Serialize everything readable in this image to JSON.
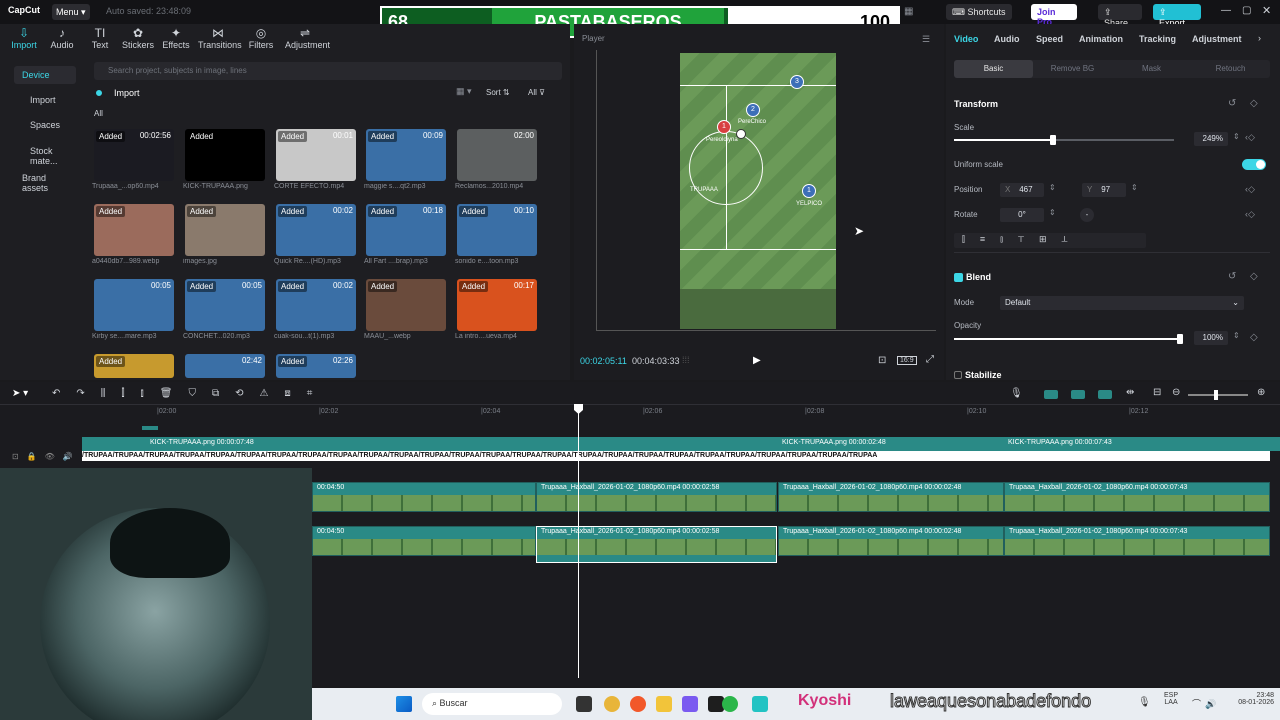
{
  "app": {
    "logo": "CapCut",
    "menu": "Menu",
    "autosave": "Auto saved: 23:48:09"
  },
  "window_buttons": {
    "shortcuts": "Shortcuts",
    "join_pro": "Join Pro",
    "share": "Share",
    "export": "Export"
  },
  "scoreboard": {
    "left_score": "68",
    "team": "PASTABASEROS",
    "right_score": "100"
  },
  "toolbar": [
    {
      "label": "Import",
      "icon": "import-icon"
    },
    {
      "label": "Audio",
      "icon": "audio-icon"
    },
    {
      "label": "Text",
      "icon": "text-icon"
    },
    {
      "label": "Stickers",
      "icon": "sticker-icon"
    },
    {
      "label": "Effects",
      "icon": "effects-icon"
    },
    {
      "label": "Transitions",
      "icon": "transitions-icon"
    },
    {
      "label": "Filters",
      "icon": "filters-icon"
    },
    {
      "label": "Adjustment",
      "icon": "adjustment-icon"
    }
  ],
  "sidebar": [
    "Device",
    "Import",
    "Spaces",
    "Stock mate...",
    "Brand assets"
  ],
  "media": {
    "search_placeholder": "Search project, subjects in image, lines",
    "import_label": "Import",
    "filter_all": "All",
    "sort": "Sort",
    "all_btn": "All",
    "items": [
      {
        "name": "Trupaaa_...op60.mp4",
        "badge": "Added",
        "dur": "00:02:56",
        "color": "#1b1b22"
      },
      {
        "name": "KICK-TRUPAAA.png",
        "badge": "Added",
        "dur": "",
        "color": "#000000"
      },
      {
        "name": "CORTE EFECTO.mp4",
        "badge": "Added",
        "dur": "00:01",
        "color": "#c8c8c8"
      },
      {
        "name": "maggie s....qt2.mp3",
        "badge": "Added",
        "dur": "00:09",
        "color": "#3a6fa6"
      },
      {
        "name": "Reclamos...2010.mp4",
        "badge": "",
        "dur": "02:00",
        "color": "#5c5f60"
      },
      {
        "name": "a0440db7...989.webp",
        "badge": "Added",
        "dur": "",
        "color": "#9b6b5c"
      },
      {
        "name": "images.jpg",
        "badge": "Added",
        "dur": "",
        "color": "#8a7a6c"
      },
      {
        "name": "Quick Re....(HD).mp3",
        "badge": "Added",
        "dur": "00:02",
        "color": "#3a6fa6"
      },
      {
        "name": "All Fart ....brap).mp3",
        "badge": "Added",
        "dur": "00:18",
        "color": "#3a6fa6"
      },
      {
        "name": "sonido e....toon.mp3",
        "badge": "Added",
        "dur": "00:10",
        "color": "#3a6fa6"
      },
      {
        "name": "Kirby se....mare.mp3",
        "badge": "",
        "dur": "00:05",
        "color": "#3a6fa6"
      },
      {
        "name": "CONCHET...020.mp3",
        "badge": "Added",
        "dur": "00:05",
        "color": "#3a6fa6"
      },
      {
        "name": "cuak-sou...t(1).mp3",
        "badge": "Added",
        "dur": "00:02",
        "color": "#3a6fa6"
      },
      {
        "name": "MAAU_...webp",
        "badge": "Added",
        "dur": "",
        "color": "#6a4b3c"
      },
      {
        "name": "La intro....ueva.mp4",
        "badge": "Added",
        "dur": "00:17",
        "color": "#d9521e"
      },
      {
        "name": "",
        "badge": "Added",
        "dur": "",
        "color": "#c79a2e"
      },
      {
        "name": "",
        "badge": "",
        "dur": "02:42",
        "color": "#3a6fa6"
      },
      {
        "name": "",
        "badge": "Added",
        "dur": "02:26",
        "color": "#3a6fa6"
      }
    ]
  },
  "player": {
    "title": "Player",
    "current": "00:02:05:11",
    "total": "00:04:03:33",
    "ratio": "16:9",
    "players": [
      {
        "num": "3",
        "name": ""
      },
      {
        "num": "2",
        "name": "PereChico"
      },
      {
        "num": "1",
        "name": "Pereoloiyna"
      },
      {
        "num": "1",
        "name": "YELPICO"
      }
    ],
    "field_label": "TRUPAAA"
  },
  "properties": {
    "tabs": [
      "Video",
      "Audio",
      "Speed",
      "Animation",
      "Tracking",
      "Adjustment"
    ],
    "subtabs": [
      "Basic",
      "Remove BG",
      "Mask",
      "Retouch"
    ],
    "transform": "Transform",
    "scale_label": "Scale",
    "scale_value": "249%",
    "scale_fraction": 0.45,
    "uniform_scale": "Uniform scale",
    "position": "Position",
    "pos_x_label": "X",
    "pos_x": "467",
    "pos_y_label": "Y",
    "pos_y": "97",
    "rotate": "Rotate",
    "rotate_value": "0°",
    "rotate_reset": "-",
    "blend": "Blend",
    "mode_label": "Mode",
    "mode_value": "Default",
    "opacity_label": "Opacity",
    "opacity_value": "100%",
    "opacity_fraction": 1.0,
    "stabilize": "Stabilize"
  },
  "timeline": {
    "ruler": [
      "|02:00",
      "|02:02",
      "|02:04",
      "|02:06",
      "|02:08",
      "|02:10",
      "|02:12"
    ],
    "overlay_clips": [
      {
        "label": "KICK-TRUPAAA.png  00:00:07:48"
      },
      {
        "label": "KICK-TRUPAAA.png  00:00:02:48"
      },
      {
        "label": "KICK-TRUPAAA.png  00:00:07:43"
      }
    ],
    "strip_text": "/TRUPAA/TRUPAA/TRUPAA/TRUPAA/TRUPAA/TRUPAA/TRUPAA/TRUPAA/TRUPAA/TRUPAA/TRUPAA/TRUPAA/TRUPAA/TRUPAA/TRUPAA/TRUPAA/TRUPAA/TRUPAA/TRUPAA/TRUPAA/TRUPAA/TRUPAA/TRUPAA/TRUPAA/TRUPAA/TRUPAA",
    "row1": [
      {
        "label": "00:04:50"
      },
      {
        "label": "Trupaaa_Haxball_2026-01-02_1080p60.mp4  00:00:02:58"
      },
      {
        "label": "Trupaaa_Haxball_2026-01-02_1080p60.mp4  00:00:02:48"
      },
      {
        "label": "Trupaaa_Haxball_2026-01-02_1080p60.mp4  00:00:07:43"
      }
    ],
    "row2": [
      {
        "label": "00:04:50"
      },
      {
        "label": "Trupaaa_Haxball_2026-01-02_1080p60.mp4  00:00:02:58"
      },
      {
        "label": "Trupaaa_Haxball_2026-01-02_1080p60.mp4  00:00:02:48"
      },
      {
        "label": "Trupaaa_Haxball_2026-01-02_1080p60.mp4  00:00:07:43"
      }
    ]
  },
  "taskbar": {
    "search": "Buscar",
    "overlay_text": "laweaquesonabadefondo",
    "overlay_user": "Kyoshi",
    "lang_top": "ESP",
    "lang_bottom": "LAA",
    "time": "23:48",
    "date": "08-01-2026"
  },
  "colors": {
    "accent": "#3cd6e6",
    "clip": "#2a8a86",
    "selected_clip_border": "#ffffff"
  }
}
